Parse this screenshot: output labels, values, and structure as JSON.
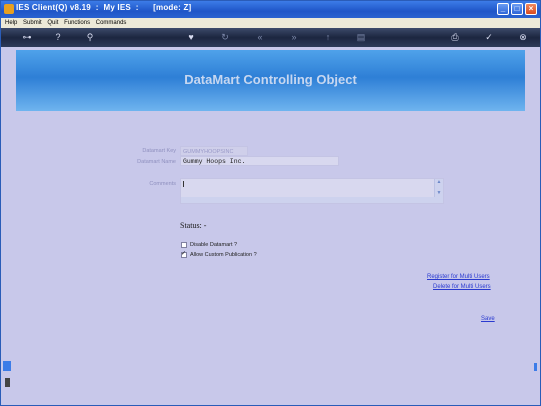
{
  "window": {
    "title": "IES Client(Q) v8.19  :  My IES  :      [mode: Z]",
    "controls": [
      "_",
      "□",
      "×"
    ]
  },
  "menu": {
    "items": [
      "Help",
      "Submit",
      "Quit",
      "Functions",
      "Commands"
    ]
  },
  "toolbar": {
    "icons": [
      "key-icon",
      "help-icon",
      "search-icon",
      "heart-icon",
      "refresh-icon",
      "back-icon",
      "forward-icon",
      "up-icon",
      "folder-icon",
      "printer-icon",
      "check-icon",
      "close-icon"
    ],
    "glyphs": {
      "key": "⊶",
      "help": "?",
      "search": "⚲",
      "heart": "♥",
      "refresh": "↻",
      "back": "«",
      "forward": "»",
      "up": "↑",
      "folder": "▤",
      "printer": "⎙",
      "check": "✓",
      "close": "⊗"
    }
  },
  "banner": {
    "title": "DataMart Controlling Object"
  },
  "form": {
    "datamart_key_label": "Datamart Key",
    "datamart_key_value": "GUMMYHOOPSINC",
    "datamart_name_label": "Datamart Name",
    "datamart_name_value": "Gummy Hoops Inc.",
    "comments_label": "Comments",
    "comments_value": ""
  },
  "status": {
    "label": "Status: -"
  },
  "options": [
    {
      "label": "Disable Datamart ?",
      "checked": false
    },
    {
      "label": "Allow Custom Publication ?",
      "checked": true
    }
  ],
  "links": {
    "register": "Register for Multi Users",
    "delete": "Delete for Multi Users",
    "save": "Save"
  }
}
